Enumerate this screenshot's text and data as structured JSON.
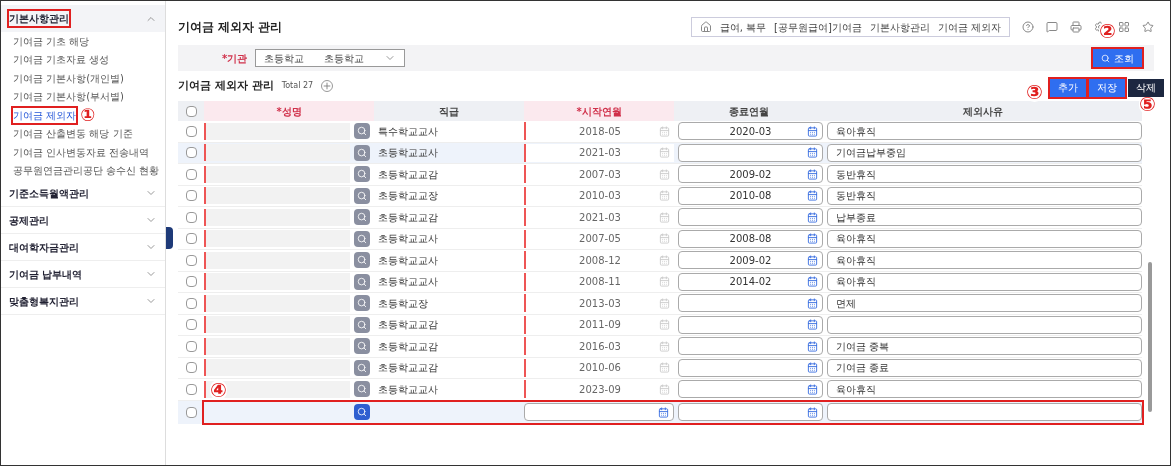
{
  "sidebar": {
    "groups": [
      {
        "label": "기본사항관리",
        "expanded": true,
        "outlined": true,
        "items": [
          {
            "label": "기여금 기초 해당",
            "selected": false
          },
          {
            "label": "기여금 기초자료 생성",
            "selected": false
          },
          {
            "label": "기여금 기본사항(개인별)",
            "selected": false
          },
          {
            "label": "기여금 기본사항(부서별)",
            "selected": false
          },
          {
            "label": "기여금 제외자",
            "selected": true,
            "outlined": true,
            "callout": "①"
          },
          {
            "label": "기여금 산출변동 해당 기준",
            "selected": false
          },
          {
            "label": "기여금 인사변동자료 전송내역",
            "selected": false
          },
          {
            "label": "공무원연금관리공단 송수신 현황",
            "selected": false
          }
        ]
      },
      {
        "label": "기준소득월액관리",
        "expanded": false
      },
      {
        "label": "공제관리",
        "expanded": false
      },
      {
        "label": "대여학자금관리",
        "expanded": false
      },
      {
        "label": "기여금 납부내역",
        "expanded": false
      },
      {
        "label": "맞춤형복지관리",
        "expanded": false
      }
    ]
  },
  "page_title": "기여금 제외자 관리",
  "breadcrumb": [
    "급여, 복무",
    "[공무원급여]기여금",
    "기본사항관리",
    "기여금 제외자"
  ],
  "filter": {
    "label": "*기관",
    "value_1": "초등학교",
    "value_2": "초등학교"
  },
  "search_button": {
    "label": "조회",
    "outlined": true,
    "callout": "②"
  },
  "section": {
    "title": "기여금 제외자 관리",
    "total": "Total 27"
  },
  "actions": [
    {
      "label": "추가",
      "kind": "primary",
      "outlined": true,
      "callout": "③"
    },
    {
      "label": "저장",
      "kind": "primary",
      "outlined": true,
      "callout": "⑤"
    },
    {
      "label": "삭제",
      "kind": "dark",
      "outlined": false
    }
  ],
  "table": {
    "select_all_checked": false,
    "columns": [
      {
        "label": "*성명",
        "required": true
      },
      {
        "label": "직급",
        "required": false
      },
      {
        "label": "*시작연월",
        "required": true
      },
      {
        "label": "종료연월",
        "required": false
      },
      {
        "label": "제외사유",
        "required": false
      }
    ],
    "rows": [
      {
        "rank": "특수학교교사",
        "start": "2018-05",
        "end": "2020-03",
        "reason": "육아휴직",
        "selected": false,
        "checked": false
      },
      {
        "rank": "초등학교교사",
        "start": "2021-03",
        "end": "",
        "reason": "기여금납부중임",
        "selected": true,
        "checked": false
      },
      {
        "rank": "초등학교교감",
        "start": "2007-03",
        "end": "2009-02",
        "reason": "동반휴직",
        "selected": false,
        "checked": false
      },
      {
        "rank": "초등학교교장",
        "start": "2010-03",
        "end": "2010-08",
        "reason": "동반휴직",
        "selected": false,
        "checked": false
      },
      {
        "rank": "초등학교교감",
        "start": "2021-03",
        "end": "",
        "reason": "납부종료",
        "selected": false,
        "checked": false
      },
      {
        "rank": "초등학교교사",
        "start": "2007-05",
        "end": "2008-08",
        "reason": "육아휴직",
        "selected": false,
        "checked": false
      },
      {
        "rank": "초등학교교사",
        "start": "2008-12",
        "end": "2009-02",
        "reason": "육아휴직",
        "selected": false,
        "checked": false
      },
      {
        "rank": "초등학교교사",
        "start": "2008-11",
        "end": "2014-02",
        "reason": "육아휴직",
        "selected": false,
        "checked": false
      },
      {
        "rank": "초등학교장",
        "start": "2013-03",
        "end": "",
        "reason": "면제",
        "selected": false,
        "checked": false
      },
      {
        "rank": "초등학교교감",
        "start": "2011-09",
        "end": "",
        "reason": "",
        "selected": false,
        "checked": false
      },
      {
        "rank": "초등학교교감",
        "start": "2016-03",
        "end": "",
        "reason": "기여금 중복",
        "selected": false,
        "checked": false
      },
      {
        "rank": "초등학교교감",
        "start": "2010-06",
        "end": "",
        "reason": "기여금 종료",
        "selected": false,
        "checked": false
      },
      {
        "rank": "초등학교교사",
        "start": "2023-09",
        "end": "",
        "reason": "육아휴직",
        "selected": false,
        "checked": false
      }
    ],
    "new_row": {
      "outlined": true,
      "checked": false,
      "callout": "④"
    }
  }
}
